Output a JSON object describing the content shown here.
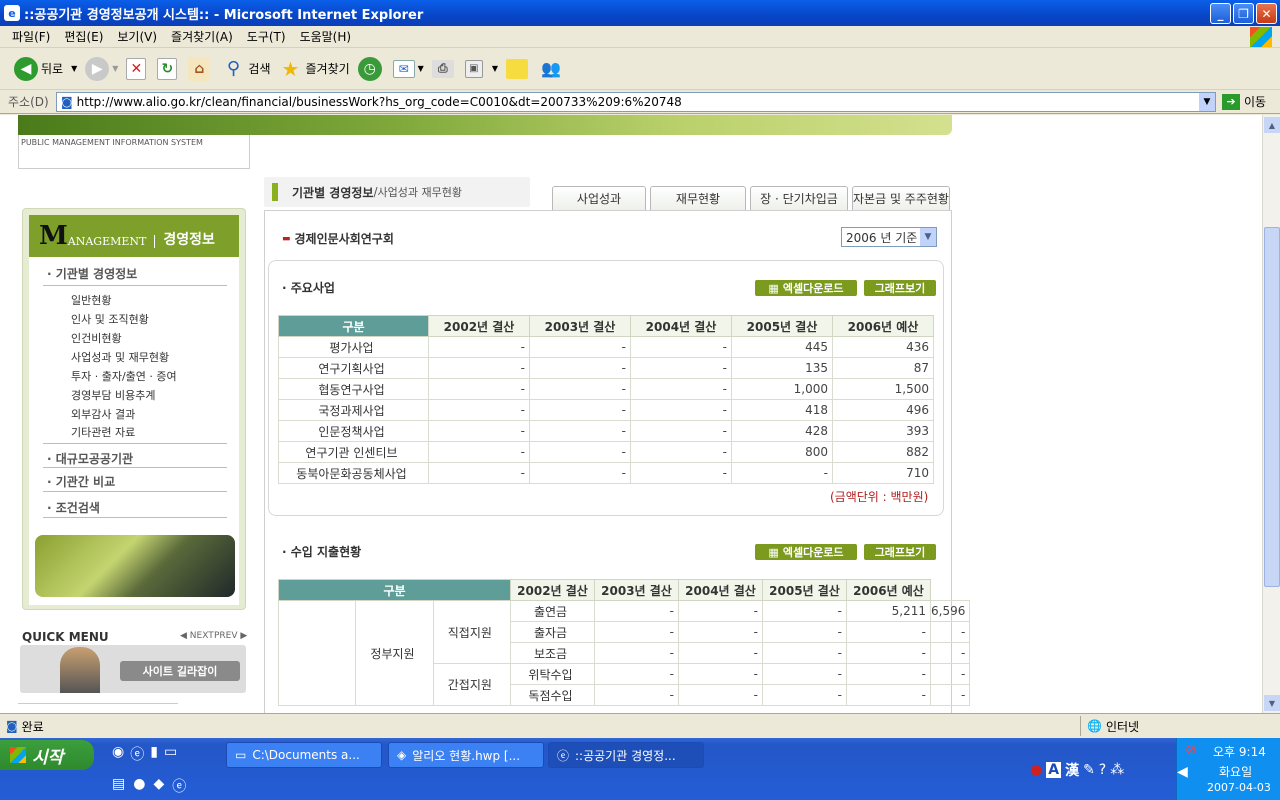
{
  "window": {
    "title": "::공공기관 경영정보공개 시스템:: - Microsoft Internet Explorer"
  },
  "menu": [
    "파일(F)",
    "편집(E)",
    "보기(V)",
    "즐겨찾기(A)",
    "도구(T)",
    "도움말(H)"
  ],
  "toolbar": {
    "back": "뒤로",
    "search": "검색",
    "favorites": "즐겨찾기"
  },
  "address": {
    "label": "주소(D)",
    "url": "http://www.alio.go.kr/clean/financial/businessWork?hs_org_code=C0010&dt=200733%209:6%20748",
    "go": "이동"
  },
  "site": {
    "pmis": "PUBLIC MANAGEMENT INFORMATION SYSTEM",
    "mgmt_m": "M",
    "mgmt_rest": "ANAGEMENT",
    "mgmt_kor": "경영정보",
    "breadcrumb_main": "기관별 경영정보",
    "breadcrumb_sep": " / ",
    "breadcrumb_sub": "사업성과 재무현황",
    "tabs": [
      "사업성과",
      "재무현황",
      "장 · 단기차입금",
      "자본금 및 주주현황"
    ],
    "org_name": "경제인문사회연구회",
    "year_select": "2006 년 기준"
  },
  "sidebar": {
    "section1": "기관별 경영정보",
    "items": [
      "일반현황",
      "인사 및 조직현황",
      "인건비현황",
      "사업성과 및 재무현황",
      "투자 · 출자/출연 · 증여",
      "경영부담 비용추계",
      "외부감사 결과",
      "기타관련 자료"
    ],
    "section2": "대규모공공기관",
    "section3": "기관간 비교",
    "section4": "조건검색",
    "quick_menu": "QUICK MENU",
    "next": "◀ NEXT",
    "prev": "PREV ▶",
    "guide": "사이트 길라잡이"
  },
  "main_business": {
    "title": "주요사업",
    "excel": "엑셀다운로드",
    "graph": "그래프보기",
    "headers": [
      "구분",
      "2002년 결산",
      "2003년 결산",
      "2004년 결산",
      "2005년 결산",
      "2006년 예산"
    ],
    "rows": [
      [
        "평가사업",
        "-",
        "-",
        "-",
        "445",
        "436"
      ],
      [
        "연구기획사업",
        "-",
        "-",
        "-",
        "135",
        "87"
      ],
      [
        "협동연구사업",
        "-",
        "-",
        "-",
        "1,000",
        "1,500"
      ],
      [
        "국정과제사업",
        "-",
        "-",
        "-",
        "418",
        "496"
      ],
      [
        "인문정책사업",
        "-",
        "-",
        "-",
        "428",
        "393"
      ],
      [
        "연구기관 인센티브",
        "-",
        "-",
        "-",
        "800",
        "882"
      ],
      [
        "동북아문화공동체사업",
        "-",
        "-",
        "-",
        "-",
        "710"
      ]
    ],
    "unit": "(금액단위 : 백만원)"
  },
  "income": {
    "title": "수입 지출현황",
    "excel": "엑셀다운로드",
    "graph": "그래프보기",
    "headers": [
      "구분",
      "2002년 결산",
      "2003년 결산",
      "2004년 결산",
      "2005년 결산",
      "2006년 예산"
    ],
    "group1": "정부지원",
    "sub1": "직접지원",
    "sub2": "간접지원",
    "rows": [
      [
        "출연금",
        "-",
        "-",
        "-",
        "5,211",
        "6,596"
      ],
      [
        "출자금",
        "-",
        "-",
        "-",
        "-",
        "-"
      ],
      [
        "보조금",
        "-",
        "-",
        "-",
        "-",
        "-"
      ],
      [
        "위탁수입",
        "-",
        "-",
        "-",
        "-",
        "-"
      ],
      [
        "독점수입",
        "-",
        "-",
        "-",
        "-",
        "-"
      ]
    ]
  },
  "status": {
    "text": "완료",
    "zone": "인터넷"
  },
  "taskbar": {
    "start": "시작",
    "tasks": [
      "C:\\Documents a...",
      "알리오 현황.hwp [...",
      "::공공기관 경영정..."
    ],
    "time": "오후 9:14",
    "day": "화요일",
    "date": "2007-04-03",
    "ime": "漢"
  }
}
